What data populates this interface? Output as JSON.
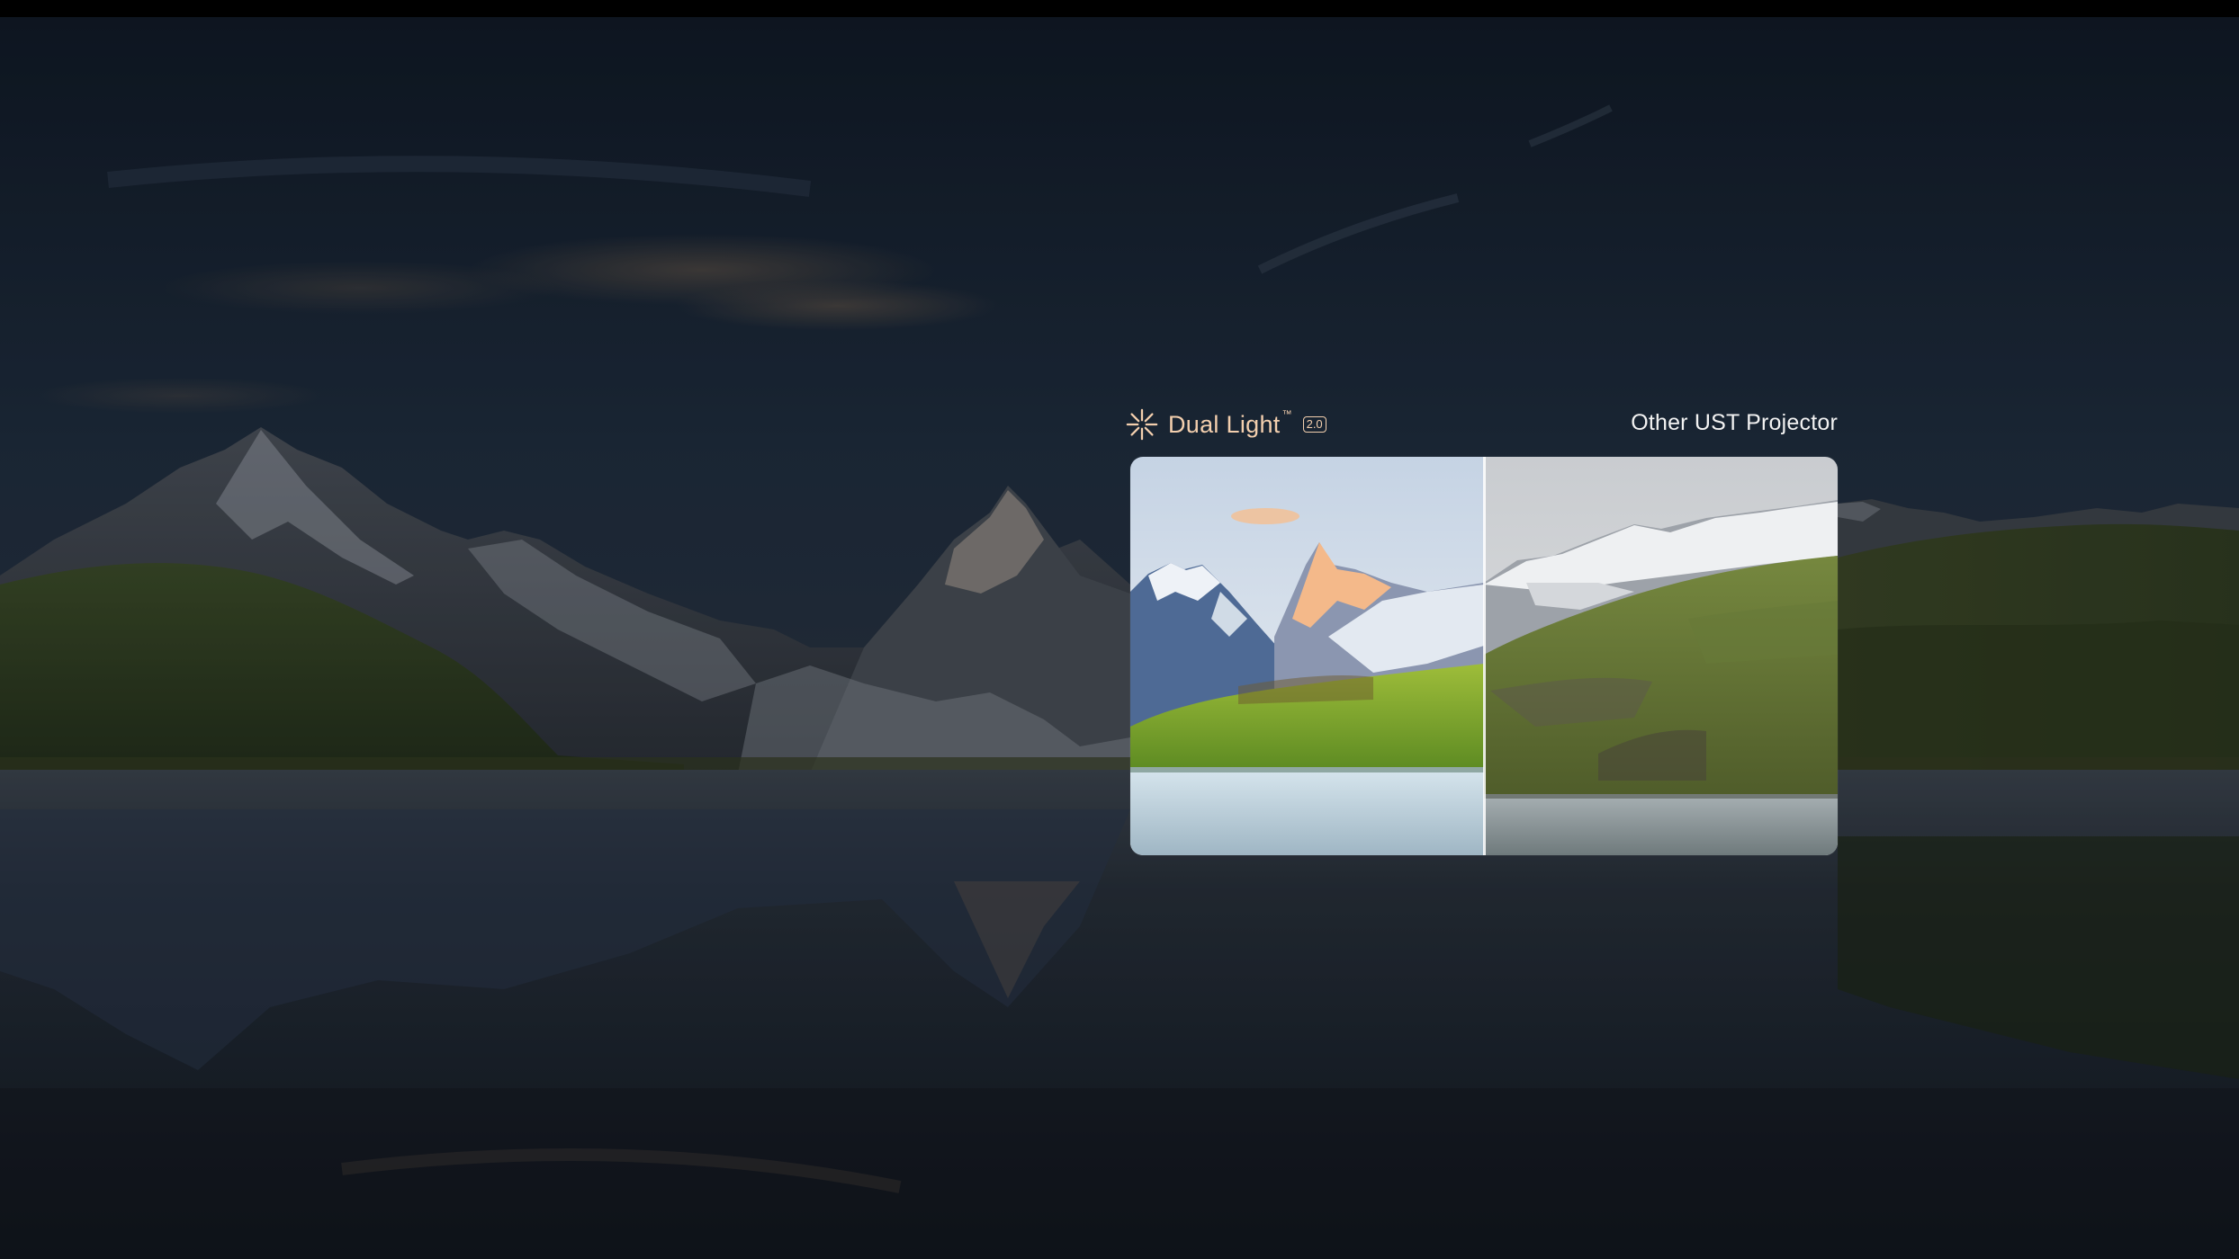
{
  "comparison": {
    "left_brand": {
      "name": "Dual Light",
      "trademark": "™",
      "version": "2.0",
      "icon": "sparkle-burst-icon",
      "color": "#f3cfae"
    },
    "right_label": "Other UST Projector"
  },
  "colors": {
    "accent": "#f3cfae",
    "divider": "#ffffff",
    "sky_dark": "#1e2a3a",
    "lake_dark": "#1b2027"
  }
}
